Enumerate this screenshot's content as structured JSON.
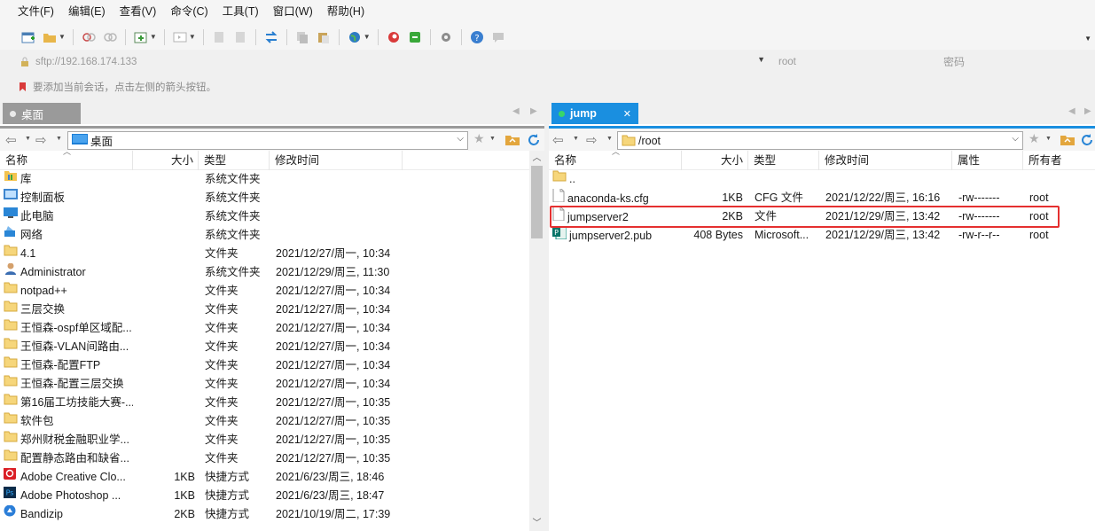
{
  "menu": [
    "文件(F)",
    "编辑(E)",
    "查看(V)",
    "命令(C)",
    "工具(T)",
    "窗口(W)",
    "帮助(H)"
  ],
  "address": {
    "host": "sftp://192.168.174.133",
    "user": "root",
    "password": "密码"
  },
  "hint": "要添加当前会话，点击左侧的箭头按钮。",
  "colors": {
    "left_accent": "#9a9a9a",
    "right_accent": "#1a8fe0",
    "highlight": "#e53030"
  },
  "left": {
    "tab": "桌面",
    "path": "桌面",
    "headers": {
      "name": "名称",
      "size": "大小",
      "type": "类型",
      "modified": "修改时间"
    },
    "rows": [
      {
        "icon": "library",
        "name": "库",
        "size": "",
        "type": "系统文件夹",
        "modified": ""
      },
      {
        "icon": "control-panel",
        "name": "控制面板",
        "size": "",
        "type": "系统文件夹",
        "modified": ""
      },
      {
        "icon": "computer",
        "name": "此电脑",
        "size": "",
        "type": "系统文件夹",
        "modified": ""
      },
      {
        "icon": "network",
        "name": "网络",
        "size": "",
        "type": "系统文件夹",
        "modified": ""
      },
      {
        "icon": "folder",
        "name": "4.1",
        "size": "",
        "type": "文件夹",
        "modified": "2021/12/27/周一, 10:34"
      },
      {
        "icon": "user",
        "name": "Administrator",
        "size": "",
        "type": "系统文件夹",
        "modified": "2021/12/29/周三, 11:30"
      },
      {
        "icon": "folder",
        "name": "notpad++",
        "size": "",
        "type": "文件夹",
        "modified": "2021/12/27/周一, 10:34"
      },
      {
        "icon": "folder",
        "name": "三层交换",
        "size": "",
        "type": "文件夹",
        "modified": "2021/12/27/周一, 10:34"
      },
      {
        "icon": "folder",
        "name": "王恒森-ospf单区域配...",
        "size": "",
        "type": "文件夹",
        "modified": "2021/12/27/周一, 10:34"
      },
      {
        "icon": "folder",
        "name": "王恒森-VLAN间路由...",
        "size": "",
        "type": "文件夹",
        "modified": "2021/12/27/周一, 10:34"
      },
      {
        "icon": "folder",
        "name": "王恒森-配置FTP",
        "size": "",
        "type": "文件夹",
        "modified": "2021/12/27/周一, 10:34"
      },
      {
        "icon": "folder",
        "name": "王恒森-配置三层交换",
        "size": "",
        "type": "文件夹",
        "modified": "2021/12/27/周一, 10:34"
      },
      {
        "icon": "folder",
        "name": "第16届工坊技能大赛-...",
        "size": "",
        "type": "文件夹",
        "modified": "2021/12/27/周一, 10:35"
      },
      {
        "icon": "folder",
        "name": "软件包",
        "size": "",
        "type": "文件夹",
        "modified": "2021/12/27/周一, 10:35"
      },
      {
        "icon": "folder",
        "name": "郑州财税金融职业学...",
        "size": "",
        "type": "文件夹",
        "modified": "2021/12/27/周一, 10:35"
      },
      {
        "icon": "folder",
        "name": "配置静态路由和缺省...",
        "size": "",
        "type": "文件夹",
        "modified": "2021/12/27/周一, 10:35"
      },
      {
        "icon": "adobe-cc",
        "name": "Adobe Creative Clo...",
        "size": "1KB",
        "type": "快捷方式",
        "modified": "2021/6/23/周三, 18:46"
      },
      {
        "icon": "photoshop",
        "name": "Adobe Photoshop ...",
        "size": "1KB",
        "type": "快捷方式",
        "modified": "2021/6/23/周三, 18:47"
      },
      {
        "icon": "bandizip",
        "name": "Bandizip",
        "size": "2KB",
        "type": "快捷方式",
        "modified": "2021/10/19/周二, 17:39"
      }
    ]
  },
  "right": {
    "tab": "jump",
    "path": "/root",
    "headers": {
      "name": "名称",
      "size": "大小",
      "type": "类型",
      "modified": "修改时间",
      "attr": "属性",
      "owner": "所有者"
    },
    "rows": [
      {
        "icon": "folder",
        "name": "..",
        "size": "",
        "type": "",
        "modified": "",
        "attr": "",
        "owner": ""
      },
      {
        "icon": "file",
        "name": "anaconda-ks.cfg",
        "size": "1KB",
        "type": "CFG 文件",
        "modified": "2021/12/22/周三, 16:16",
        "attr": "-rw-------",
        "owner": "root"
      },
      {
        "icon": "file",
        "name": "jumpserver2",
        "size": "2KB",
        "type": "文件",
        "modified": "2021/12/29/周三, 13:42",
        "attr": "-rw-------",
        "owner": "root"
      },
      {
        "icon": "publisher",
        "name": "jumpserver2.pub",
        "size": "408 Bytes",
        "type": "Microsoft...",
        "modified": "2021/12/29/周三, 13:42",
        "attr": "-rw-r--r--",
        "owner": "root"
      }
    ]
  }
}
